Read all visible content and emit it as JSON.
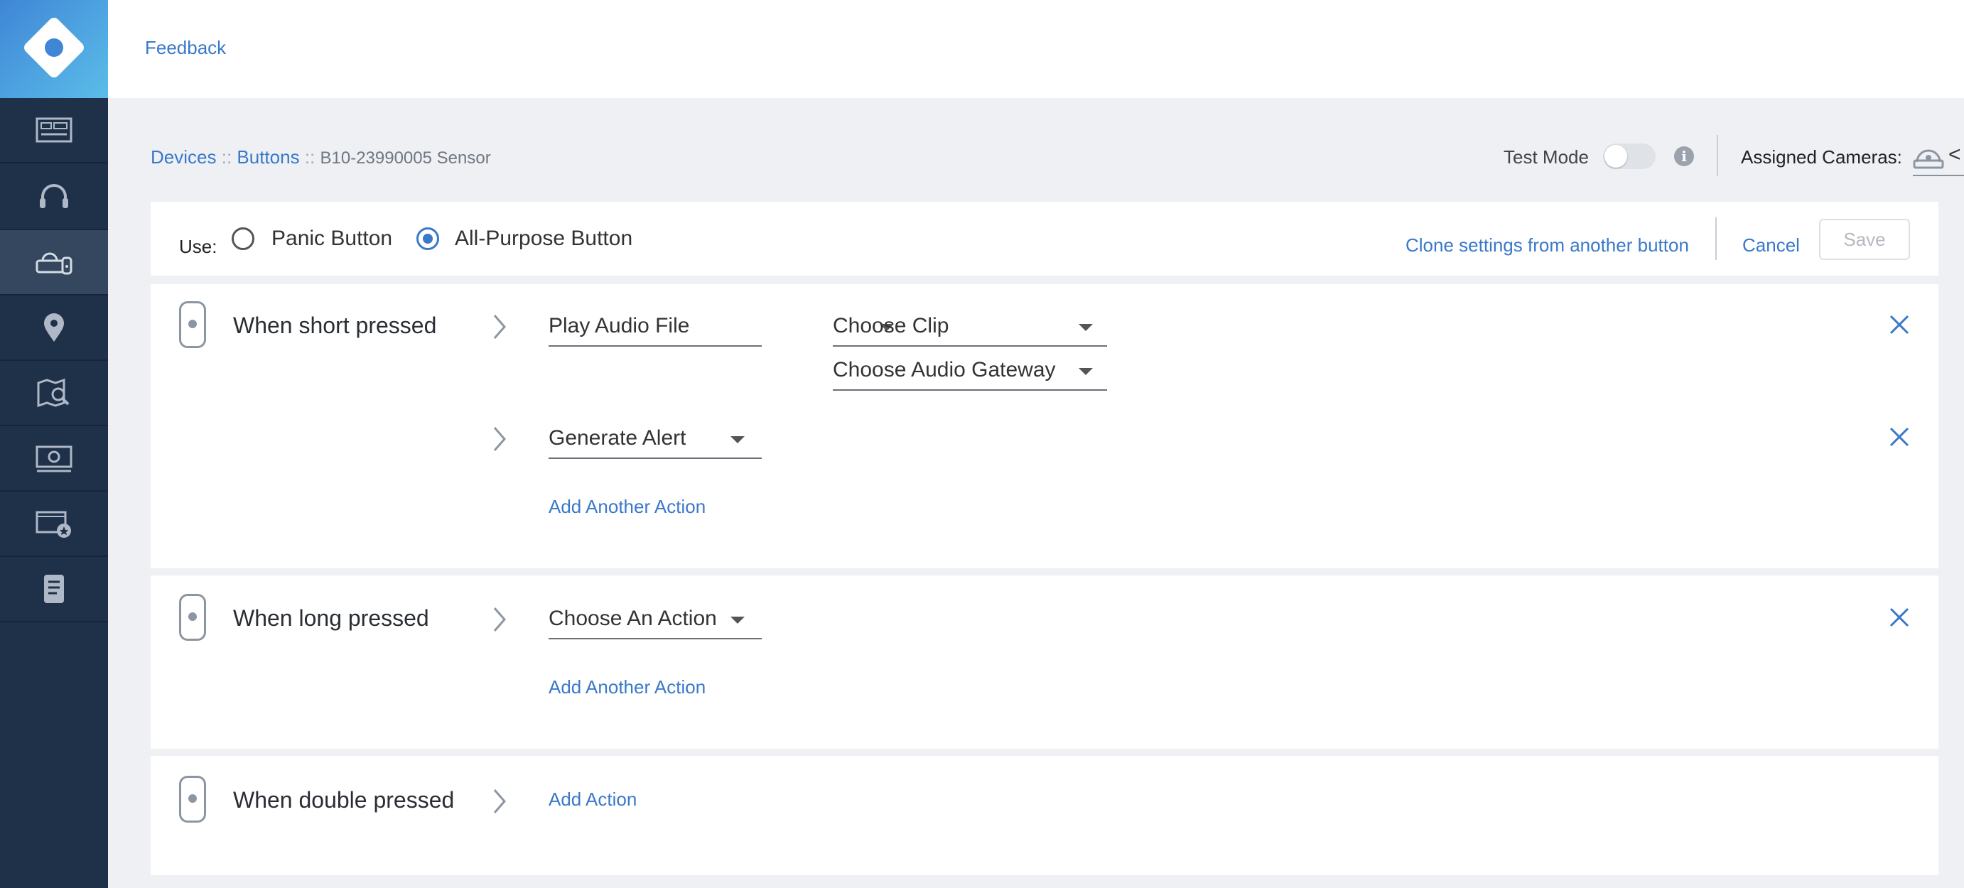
{
  "header": {
    "feedback_label": "Feedback"
  },
  "breadcrumb": {
    "devices": "Devices",
    "buttons": "Buttons",
    "separator": "::",
    "current": "B10-23990005 Sensor"
  },
  "test_mode": {
    "label": "Test Mode",
    "enabled": false
  },
  "assigned_cameras": {
    "label": "Assigned Cameras:",
    "chevron": "<"
  },
  "use_bar": {
    "label": "Use:",
    "options": [
      {
        "label": "Panic Button",
        "selected": false
      },
      {
        "label": "All-Purpose Button",
        "selected": true
      }
    ],
    "clone_label": "Clone settings from another button",
    "cancel_label": "Cancel",
    "save_label": "Save"
  },
  "triggers": {
    "short": {
      "label": "When short pressed",
      "actions": [
        {
          "value": "Play Audio File",
          "params": [
            "Choose Clip",
            "Choose Audio Gateways"
          ]
        },
        {
          "value": "Generate Alert"
        }
      ],
      "add_label": "Add Another Action"
    },
    "long": {
      "label": "When long pressed",
      "actions": [
        {
          "value": "Choose An Action"
        }
      ],
      "add_label": "Add Another Action"
    },
    "double": {
      "label": "When double pressed",
      "add_label": "Add Action"
    }
  },
  "colors": {
    "sidebar": "#1f3049",
    "accent": "#3a78c9",
    "page_bg": "#eef0f4"
  },
  "icons": [
    "logo-icon",
    "dashboard-icon",
    "headset-icon",
    "devices-icon",
    "location-pin-icon",
    "map-search-icon",
    "monitor-icon",
    "video-star-icon",
    "document-icon",
    "info-icon",
    "camera-icon",
    "pushbutton-icon",
    "chevron-right-icon",
    "close-icon"
  ]
}
